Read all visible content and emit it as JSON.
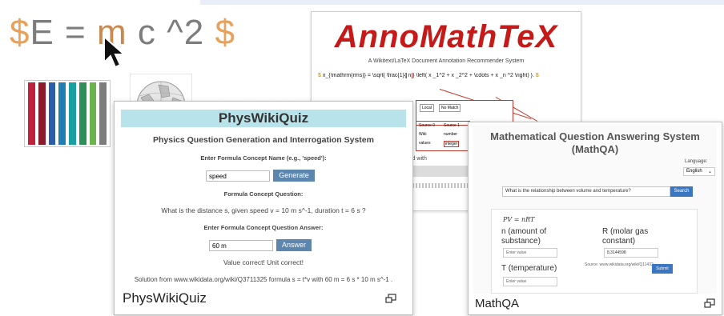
{
  "logo": {
    "parts": [
      "$",
      "E = ",
      "m",
      " c ^2 ",
      "$"
    ],
    "colors": {
      "dollar": "#e8a15a",
      "text": "#7d7d7d"
    }
  },
  "barcode_colors": [
    "#c0223b",
    "#8b1a2a",
    "#2a5ea8",
    "#1e7fb0",
    "#1aa0a0",
    "#2f8f5b",
    "#6bb34c",
    "#7d7d7d"
  ],
  "anno": {
    "title": "AnnoMathTeX",
    "subtitle": "A Wikitext/LaTeX Document Annotation Recommender System",
    "formula_start": "$",
    "formula_body": "x_{\\mathrm{rms}} = \\sqrt{ \\frac{1}{",
    "formula_n": "n",
    "formula_end": "} \\left( x _1^2 + x _2^2 + \\cdots + x _n ^2 \\right) }.",
    "panel_local": "Local",
    "panel_nomatch": "No Match",
    "table": {
      "h1": "Source 0",
      "h2": "Source 1",
      "r1c1": "Wiki",
      "r1c2": "number",
      "r2c1": "values",
      "r2c2": "integer"
    },
    "related_label": "otated with",
    "bar_text": "ger"
  },
  "phys": {
    "header": "PhysWikiQuiz",
    "subtitle": "Physics Question Generation and Interrogation System",
    "concept_label": "Enter Formula Concept Name (e.g., 'speed'):",
    "concept_value": "speed",
    "generate_label": "Generate",
    "question_label": "Formula Concept Question:",
    "question_text": "What is the distance s, given speed v = 10 m s^-1, duration t = 6 s ?",
    "answer_label": "Enter Formula Concept Question Answer:",
    "answer_value": "60 m",
    "answer_btn": "Answer",
    "feedback": "Value correct! Unit correct!",
    "solution": "Solution from www.wikidata.org/wiki/Q3711325 formula s = t*v with 60 m = 6 s * 10 m s^-1 .",
    "caption": "PhysWikiQuiz",
    "header_color": "#b9e3ea",
    "button_color": "#5c86ad"
  },
  "mqa": {
    "title_line1": "Mathematical Question Answering System",
    "title_line2": "(MathQA)",
    "language_label": "Language:",
    "language_value": "English",
    "search_value": "What is the relationship between volume and temperature?",
    "search_btn": "Search",
    "formula": "PV = nRT",
    "var_n_line1": "n (amount of",
    "var_n_line2": "substance)",
    "var_r_line1": "R (molar gas",
    "var_r_line2": "constant)",
    "var_t": "T (temperature)",
    "field_placeholder": "Enter value",
    "r_value": "8.3144598",
    "source_text": "Source: www.wikidata.org/wiki/Q11432",
    "submit_btn": "Submit",
    "caption": "MathQA",
    "button_color": "#3a77c0"
  }
}
